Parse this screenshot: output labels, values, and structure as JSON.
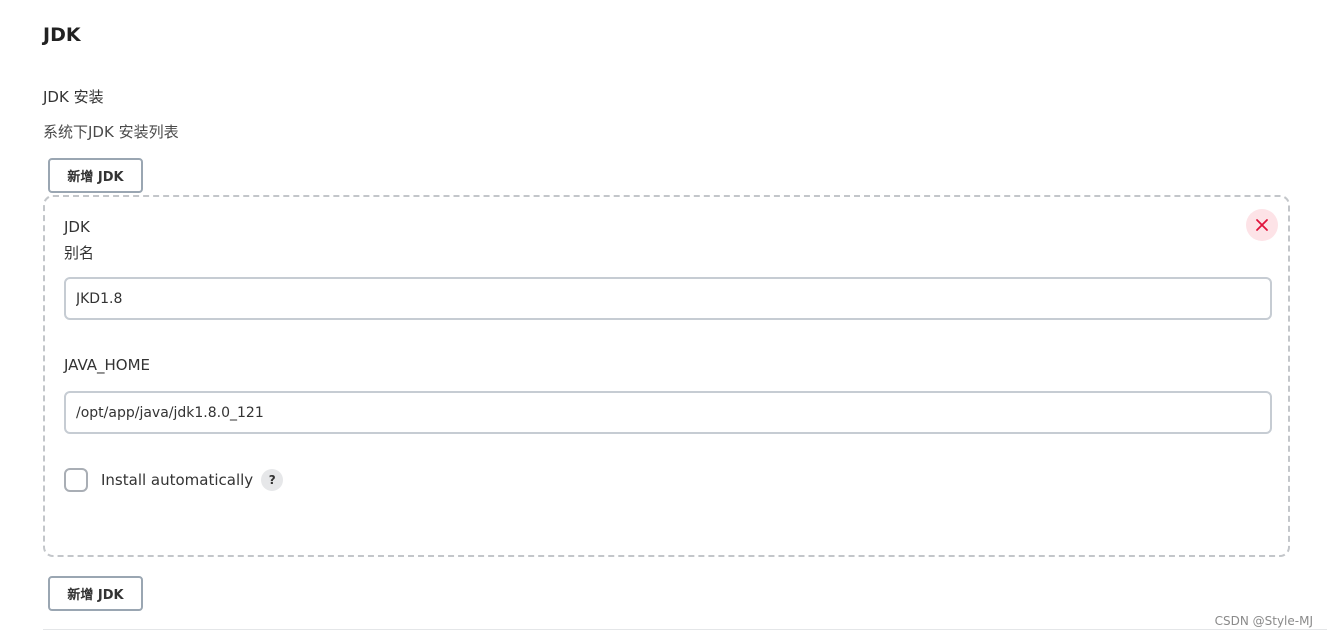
{
  "section": {
    "title": "JDK"
  },
  "setting": {
    "name": "JDK 安装",
    "description": "系统下JDK 安装列表",
    "add_button_label": "新增 JDK"
  },
  "jdk_item": {
    "type_label": "JDK",
    "alias_label": "别名",
    "alias_value": "JKD1.8",
    "java_home_label": "JAVA_HOME",
    "java_home_value": "/opt/app/java/jdk1.8.0_121",
    "install_auto_label": "Install automatically",
    "install_auto_checked": false,
    "help_glyph": "?",
    "delete_icon": "close-icon"
  },
  "watermark": "CSDN @Style-MJ",
  "colors": {
    "delete_accent": "#e0143c",
    "delete_bg": "#fde3e7"
  }
}
